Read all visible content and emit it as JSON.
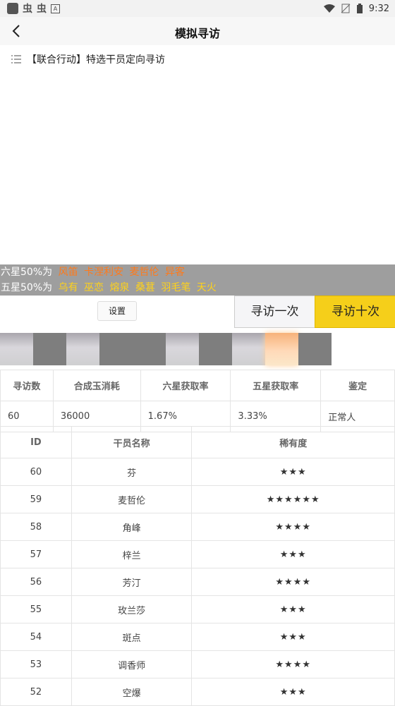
{
  "status_bar": {
    "time": "9:32",
    "left_glyphs": [
      "虫",
      "虫"
    ],
    "badge": "A"
  },
  "app_bar": {
    "title": "模拟寻访"
  },
  "banner": {
    "label": "【联合行动】特选干员定向寻访"
  },
  "rates": {
    "six_star": {
      "label": "六星50%为",
      "names": [
        "风笛",
        "卡涅利安",
        "麦哲伦",
        "异客"
      ]
    },
    "five_star": {
      "label": "五星50%为",
      "names": [
        "乌有",
        "巫恋",
        "熔泉",
        "桑葚",
        "羽毛笔",
        "天火"
      ]
    }
  },
  "controls": {
    "settings_label": "设置",
    "single_label": "寻访一次",
    "ten_label": "寻访十次"
  },
  "result_strip": [
    "light",
    "dark",
    "light",
    "dark",
    "dark",
    "light",
    "dark",
    "light",
    "orange",
    "dark"
  ],
  "stats": {
    "headers": [
      "寻访数",
      "合成玉消耗",
      "六星获取率",
      "五星获取率",
      "鉴定"
    ],
    "values": [
      "60",
      "36000",
      "1.67%",
      "3.33%",
      "正常人"
    ]
  },
  "records": {
    "headers": [
      "ID",
      "干员名称",
      "稀有度"
    ],
    "rows": [
      {
        "id": "60",
        "name": "芬",
        "stars": "★★★"
      },
      {
        "id": "59",
        "name": "麦哲伦",
        "stars": "★★★★★★"
      },
      {
        "id": "58",
        "name": "角峰",
        "stars": "★★★★"
      },
      {
        "id": "57",
        "name": "梓兰",
        "stars": "★★★"
      },
      {
        "id": "56",
        "name": "芳汀",
        "stars": "★★★★"
      },
      {
        "id": "55",
        "name": "玫兰莎",
        "stars": "★★★"
      },
      {
        "id": "54",
        "name": "斑点",
        "stars": "★★★"
      },
      {
        "id": "53",
        "name": "调香师",
        "stars": "★★★★"
      },
      {
        "id": "52",
        "name": "空爆",
        "stars": "★★★"
      }
    ]
  }
}
